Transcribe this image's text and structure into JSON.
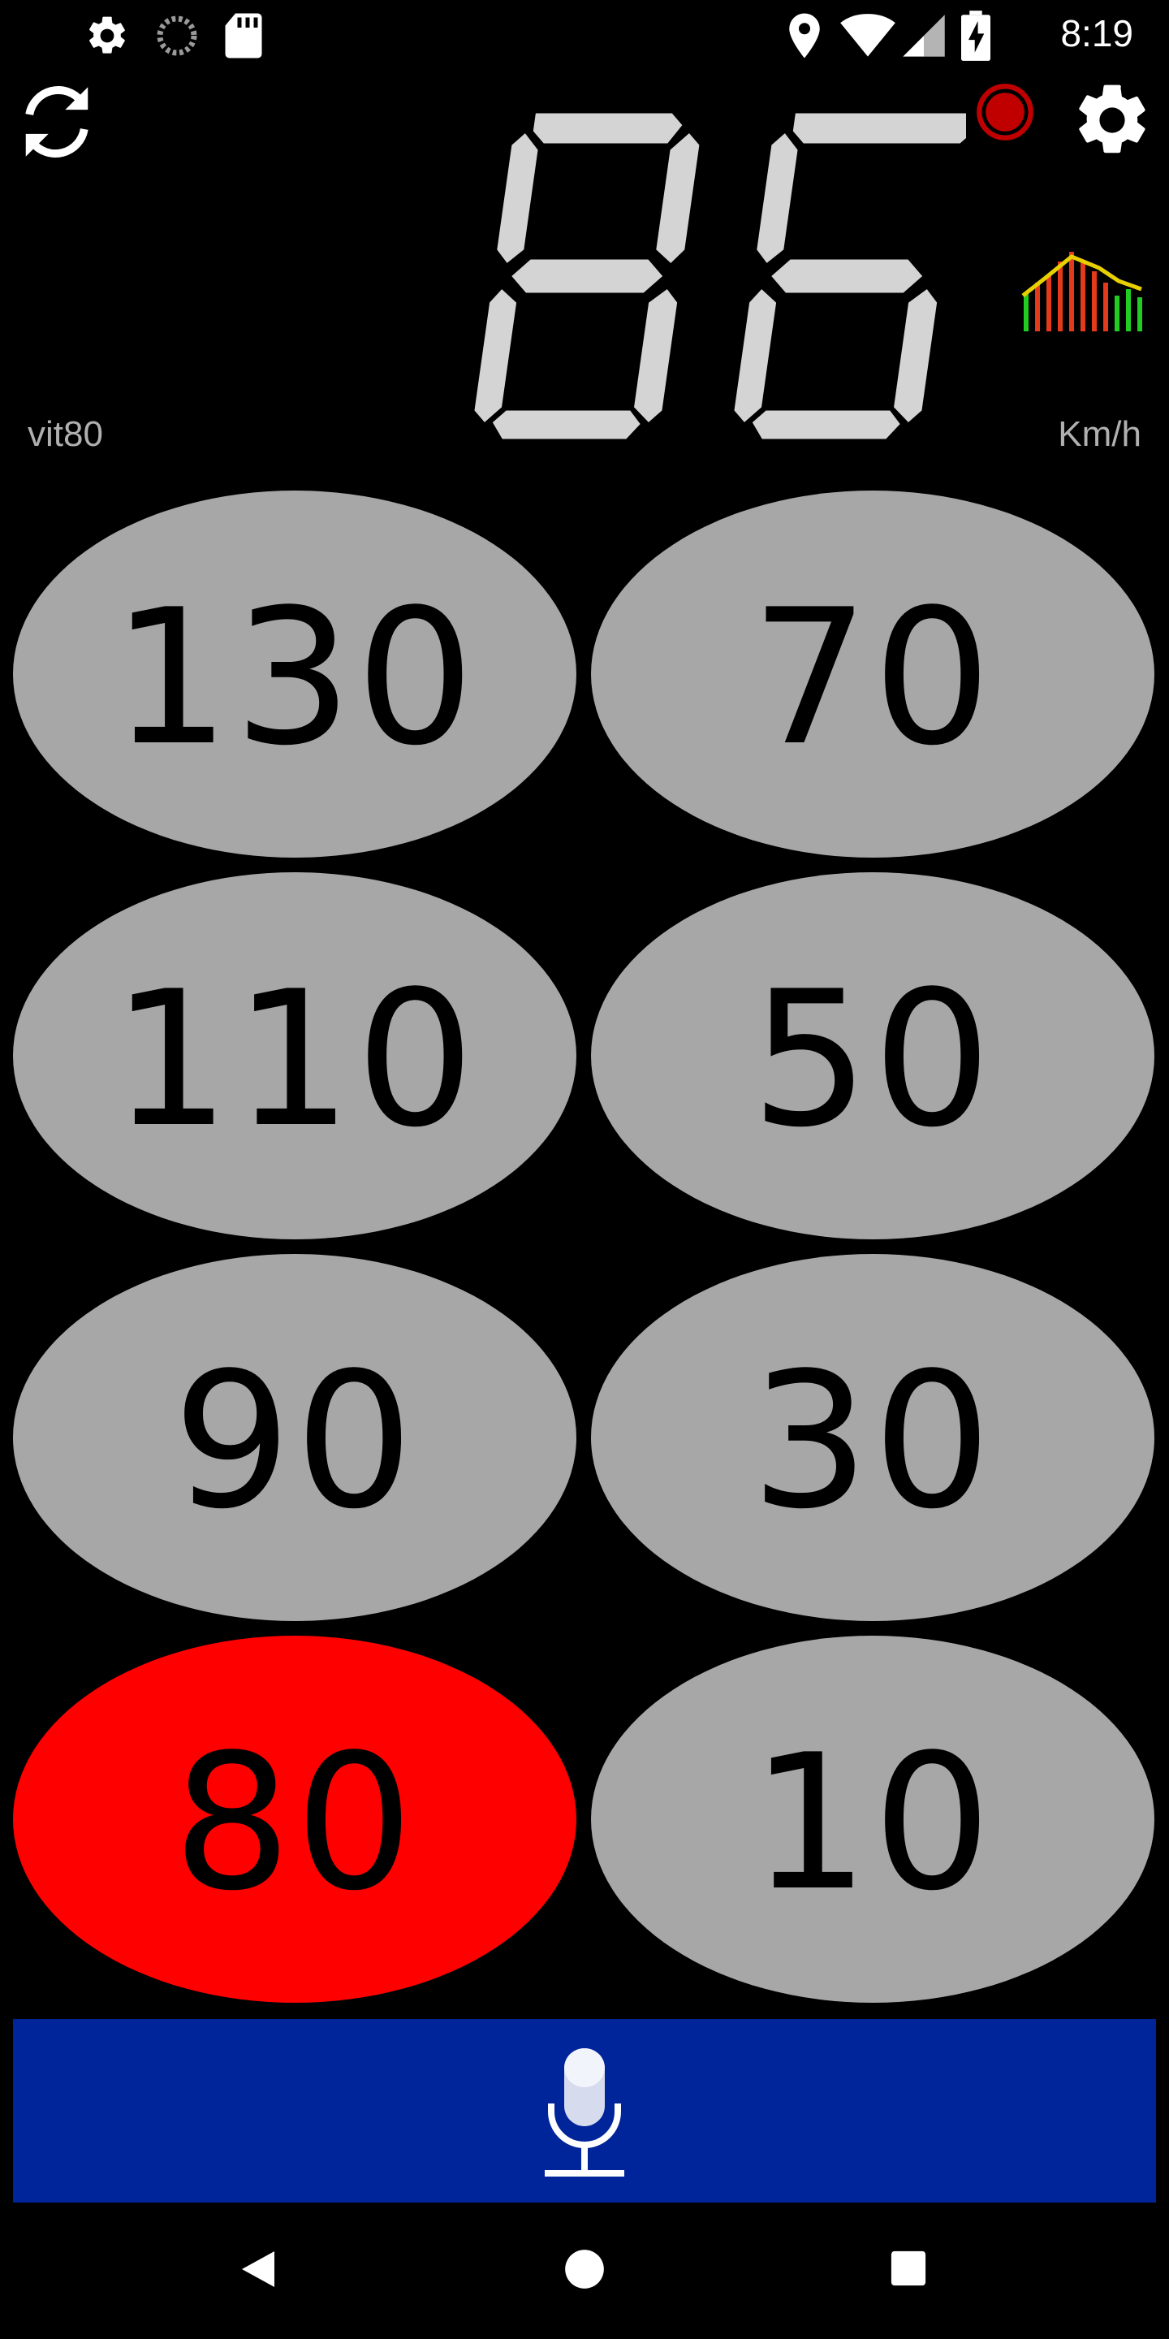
{
  "status_bar": {
    "time": "8:19",
    "left_icons": [
      "settings-icon",
      "sync-progress-icon",
      "sd-card-icon"
    ],
    "right_icons": [
      "location-icon",
      "wifi-icon",
      "signal-icon",
      "battery-charging-icon"
    ]
  },
  "header": {
    "refresh_icon": "refresh-icon",
    "record_indicator_color": "#c00000",
    "settings_icon": "settings-icon",
    "history_chart_icon": "speed-history-icon"
  },
  "speed_display": {
    "value": "86",
    "limit_label": "vit80",
    "unit": "Km/h",
    "digit_color": "#d4d4d4"
  },
  "speed_buttons": [
    {
      "label": "130",
      "active": false
    },
    {
      "label": "70",
      "active": false
    },
    {
      "label": "110",
      "active": false
    },
    {
      "label": "50",
      "active": false
    },
    {
      "label": "90",
      "active": false
    },
    {
      "label": "30",
      "active": false
    },
    {
      "label": "80",
      "active": true
    },
    {
      "label": "10",
      "active": false
    }
  ],
  "colors": {
    "button_gray": "#a7a7a7",
    "button_active": "#ff0000",
    "voice_bar": "#00249a",
    "background": "#000000"
  },
  "voice_bar": {
    "icon": "microphone-icon"
  },
  "nav_bar": {
    "icons": [
      "back-icon",
      "home-icon",
      "recents-icon"
    ]
  }
}
